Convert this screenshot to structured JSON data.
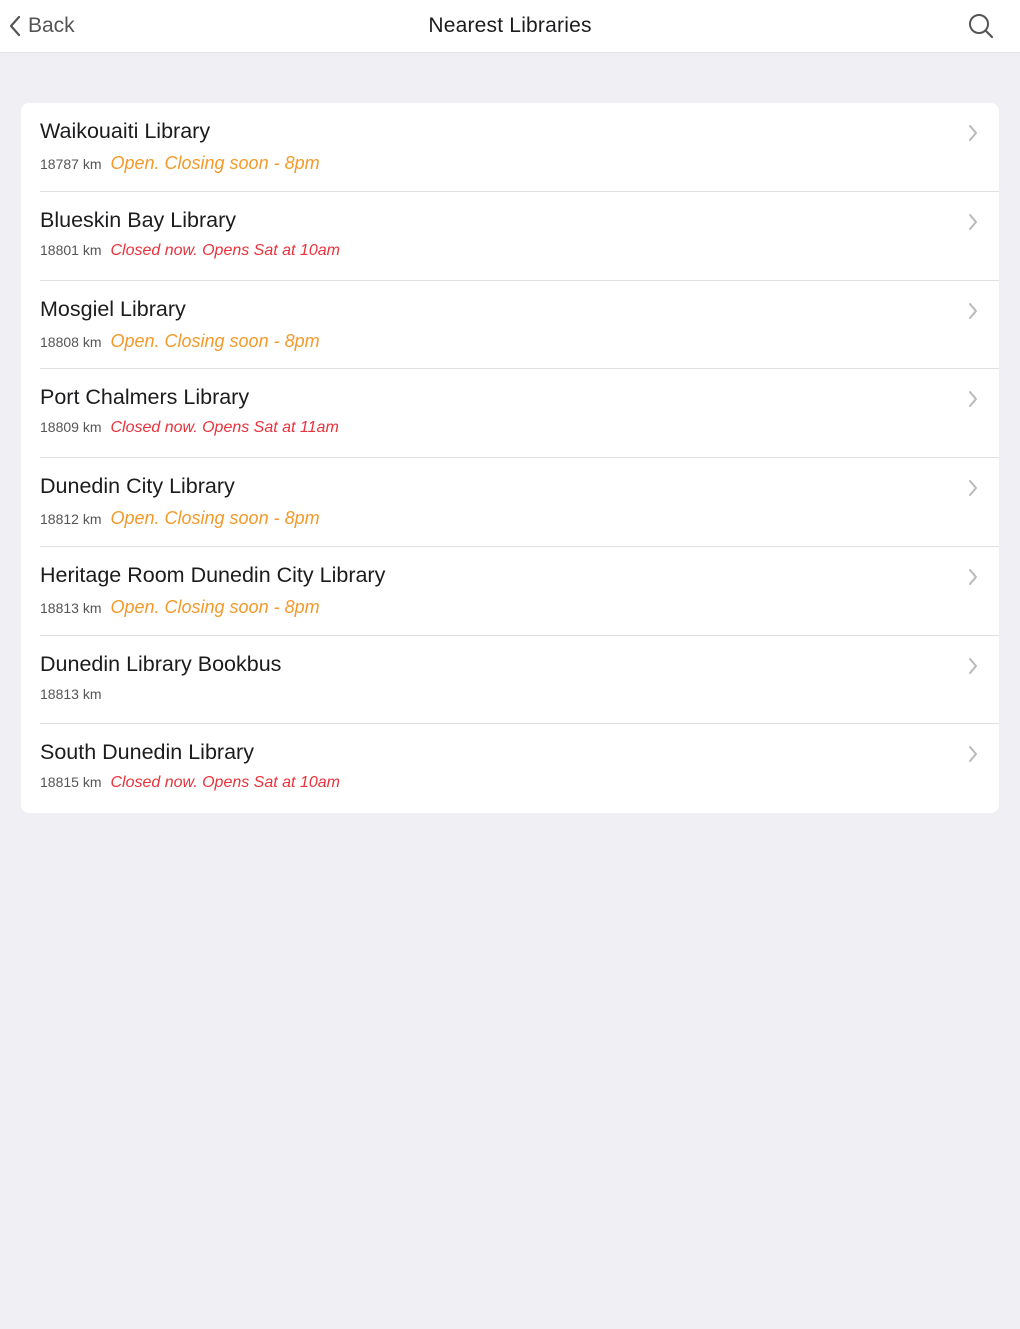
{
  "navbar": {
    "back_label": "Back",
    "title": "Nearest Libraries",
    "back_icon": "chevron-left-icon",
    "search_icon": "search-icon"
  },
  "colors": {
    "open": "#f39a2b",
    "closed": "#e8323c",
    "background": "#efeff4"
  },
  "libraries": [
    {
      "name": "Waikouaiti Library",
      "distance": "18787 km",
      "status": "Open. Closing soon - 8pm",
      "state": "open"
    },
    {
      "name": "Blueskin Bay Library",
      "distance": "18801 km",
      "status": "Closed now. Opens Sat at 10am",
      "state": "closed"
    },
    {
      "name": "Mosgiel Library",
      "distance": "18808 km",
      "status": "Open. Closing soon - 8pm",
      "state": "open"
    },
    {
      "name": "Port Chalmers Library",
      "distance": "18809 km",
      "status": "Closed now. Opens Sat at 11am",
      "state": "closed"
    },
    {
      "name": "Dunedin City Library",
      "distance": "18812 km",
      "status": "Open. Closing soon - 8pm",
      "state": "open"
    },
    {
      "name": "Heritage Room Dunedin City Library",
      "distance": "18813 km",
      "status": "Open. Closing soon - 8pm",
      "state": "open"
    },
    {
      "name": "Dunedin Library Bookbus",
      "distance": "18813 km",
      "status": "",
      "state": "none"
    },
    {
      "name": "South Dunedin Library",
      "distance": "18815 km",
      "status": "Closed now. Opens Sat at 10am",
      "state": "closed"
    }
  ]
}
